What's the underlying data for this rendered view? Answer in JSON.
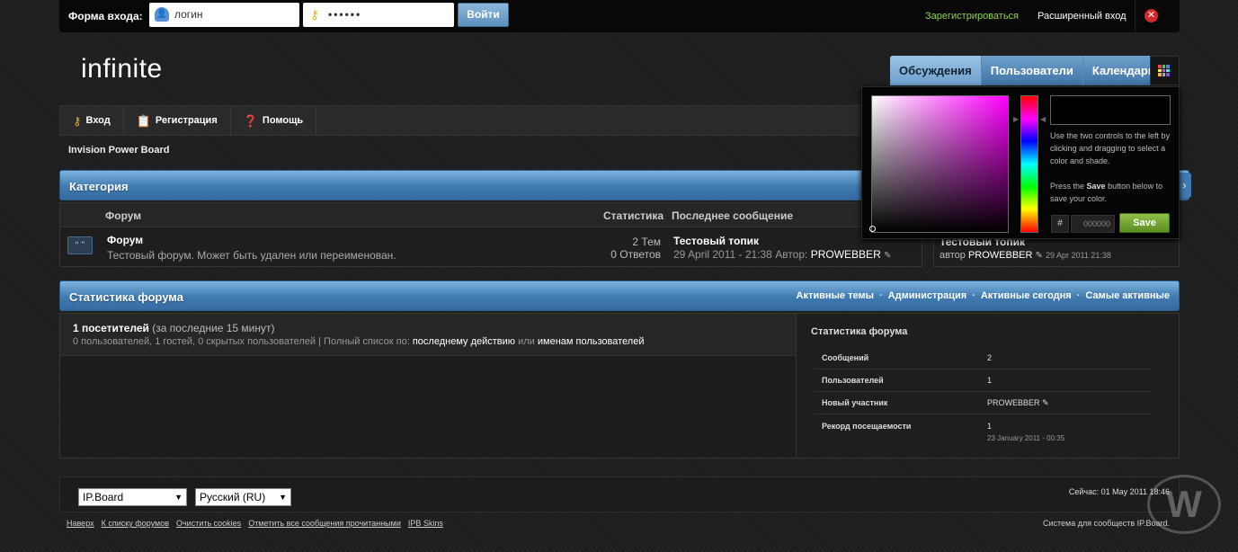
{
  "topbar": {
    "login_label": "Форма входа:",
    "login_value": "логин",
    "password_value": "••••••",
    "login_button": "Войти",
    "register_link": "Зарегистрироваться",
    "advanced_login": "Расширенный вход"
  },
  "header": {
    "logo": "infinite",
    "nav": [
      "Обсуждения",
      "Пользователи",
      "Календарь"
    ]
  },
  "userbar": {
    "items": [
      "Вход",
      "Регистрация",
      "Помощь"
    ]
  },
  "breadcrumb": "Invision Power Board",
  "category": {
    "title": "Категория",
    "columns": {
      "forum": "Форум",
      "stats": "Статистика",
      "last_post": "Последнее сообщение"
    },
    "forum": {
      "name": "Форум",
      "description": "Тестовый форум. Может быть удален или переименован.",
      "topics": "2 Тем",
      "replies": "0 Ответов",
      "last_topic": "Тестовый топик",
      "last_date": "29 April 2011 - 21:38",
      "author_label": "Автор:",
      "author": "PROWEBBER"
    }
  },
  "side_box": {
    "topic": "Тестовый топик",
    "author_label": "автор",
    "author": "PROWEBBER",
    "date": "29 Apr 2011 21:38"
  },
  "stats": {
    "title": "Статистика форума",
    "links": [
      "Активные темы",
      "Администрация",
      "Активные сегодня",
      "Самые активные"
    ],
    "online_count": "1 посетителей",
    "online_period": "(за последние 15 минут)",
    "online_detail": "0 пользователей, 1 гостей, 0 скрытых пользователей | Полный список по:",
    "by_last_action": "последнему действию",
    "or": "или",
    "by_names": "именам пользователей",
    "right_title": "Статистика форума",
    "rows": [
      {
        "label": "Сообщений",
        "value": "2"
      },
      {
        "label": "Пользователей",
        "value": "1"
      },
      {
        "label": "Новый участник",
        "value": "PROWEBBER"
      },
      {
        "label": "Рекорд посещаемости",
        "value": "1",
        "sub": "23 January 2011 - 00:35"
      }
    ]
  },
  "footer": {
    "skin": "IP.Board",
    "language": "Русский (RU)",
    "now": "Сейчас: 01 May 2011 18:46",
    "links": [
      "Наверх",
      "К списку форумов",
      "Очистить cookies",
      "Отметить все сообщения прочитанными",
      "IPB Skins"
    ],
    "powered": "Система для сообществ IP.Board."
  },
  "picker": {
    "help1": "Use the two controls to the left by clicking and dragging to select a color and shade.",
    "help2_a": "Press the",
    "help2_b": "Save",
    "help2_c": "button below to save your color.",
    "hash": "#",
    "hex": "000000",
    "save": "Save"
  },
  "watermark": "W"
}
